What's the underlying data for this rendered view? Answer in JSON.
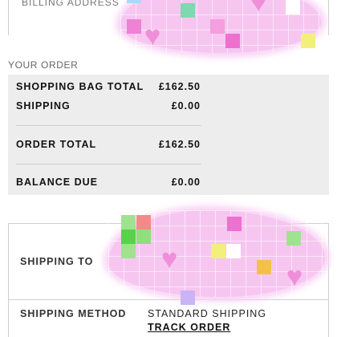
{
  "billing": {
    "label": "BILLING ADDRESS"
  },
  "order": {
    "heading": "YOUR ORDER",
    "rows": [
      {
        "label": "SHOPPING BAG TOTAL",
        "value": "£162.50"
      },
      {
        "label": "SHIPPING",
        "value": "£0.00"
      },
      {
        "label": "ORDER TOTAL",
        "value": "£162.50"
      },
      {
        "label": "BALANCE DUE",
        "value": "£0.00"
      }
    ]
  },
  "shipping": {
    "to_label": "SHIPPING TO",
    "method_label": "SHIPPING METHOD",
    "method_value": "STANDARD SHIPPING",
    "track_label": "TRACK ORDER"
  },
  "colors": {
    "sticker_pink": "#f6c6f0",
    "heart_pink": "#f08fd9",
    "order_background": "#ededed",
    "border_gray": "#cfcfcf"
  },
  "icons": {
    "decoration": "pixel-heart-sticker-icon"
  }
}
